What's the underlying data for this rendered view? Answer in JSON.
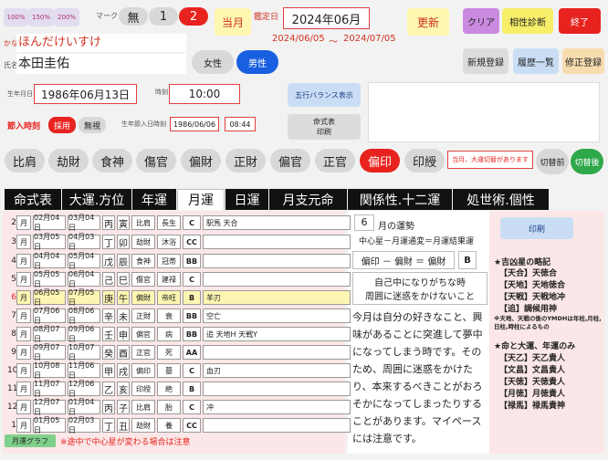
{
  "top": {
    "zoom": [
      "100%",
      "150%",
      "200%"
    ],
    "mark_label": "マーク",
    "mark_buttons": [
      "無",
      "1",
      "2"
    ],
    "current_month_label": "当月",
    "kantei_label": "鑑定日",
    "kantei_value": "2024年06月",
    "period_from": "2024/06/05",
    "period_sep": "～",
    "period_to": "2024/07/05",
    "update_label": "更新",
    "clear_label": "クリア",
    "compat_label": "相性診断",
    "exit_label": "終了",
    "new_label": "新規登録",
    "history_label": "履歴一覧",
    "fix_label": "修正登録"
  },
  "person": {
    "kana_label": "かな",
    "kana_value": "ほんだけいすけ",
    "name_label": "氏名",
    "name_value": "本田圭佑",
    "female_label": "女性",
    "male_label": "男性",
    "birth_label": "生年月日",
    "birth_value": "1986年06月13日",
    "time_label": "時刻",
    "time_value": "10:00",
    "gogyo_label": "五行バランス表示",
    "meishiki_print_line1": "命式表",
    "meishiki_print_line2": "印刷",
    "setsuiri_label": "節入時刻",
    "adopt_label": "採用",
    "ignore_label": "無視",
    "birth_setsu_label": "生年節入日時刻",
    "birth_setsu_date": "1986/06/06",
    "birth_setsu_time": "08:44"
  },
  "stars": [
    "比肩",
    "劫財",
    "食神",
    "傷官",
    "偏財",
    "正財",
    "偏官",
    "正官",
    "偏印",
    "印綬"
  ],
  "star_notice": "当月、大運切替があります",
  "switch_before": "切替前",
  "switch_after": "切替後",
  "tabs": [
    "命式表",
    "大運.方位",
    "年運",
    "月運",
    "日運",
    "月支元命",
    "関係性.十二運",
    "処世術.個性"
  ],
  "months": [
    {
      "m": "2",
      "u": "月",
      "s": "02月04日",
      "e": "03月04日",
      "g1": "丙",
      "g2": "寅",
      "star": "比肩",
      "un": "長生",
      "code": "C",
      "note": "駅馬 天合"
    },
    {
      "m": "3",
      "u": "月",
      "s": "03月05日",
      "e": "04月03日",
      "g1": "丁",
      "g2": "卯",
      "star": "劫財",
      "un": "沐浴",
      "code": "CC",
      "note": ""
    },
    {
      "m": "4",
      "u": "月",
      "s": "04月04日",
      "e": "05月04日",
      "g1": "戊",
      "g2": "辰",
      "star": "食神",
      "un": "冠帯",
      "code": "BB",
      "note": ""
    },
    {
      "m": "5",
      "u": "月",
      "s": "05月05日",
      "e": "06月04日",
      "g1": "己",
      "g2": "巳",
      "star": "傷官",
      "un": "建禄",
      "code": "C",
      "note": ""
    },
    {
      "m": "6",
      "u": "月",
      "s": "06月05日",
      "e": "07月05日",
      "g1": "庚",
      "g2": "午",
      "star": "偏財",
      "un": "帝旺",
      "code": "B",
      "note": "羊刃"
    },
    {
      "m": "7",
      "u": "月",
      "s": "07月06日",
      "e": "08月06日",
      "g1": "辛",
      "g2": "未",
      "star": "正財",
      "un": "衰",
      "code": "BB",
      "note": "空亡"
    },
    {
      "m": "8",
      "u": "月",
      "s": "08月07日",
      "e": "09月06日",
      "g1": "壬",
      "g2": "申",
      "star": "偏官",
      "un": "病",
      "code": "BB",
      "note": "追 天地H 天戦Y"
    },
    {
      "m": "9",
      "u": "月",
      "s": "09月07日",
      "e": "10月07日",
      "g1": "癸",
      "g2": "酉",
      "star": "正官",
      "un": "死",
      "code": "AA",
      "note": ""
    },
    {
      "m": "10",
      "u": "月",
      "s": "10月08日",
      "e": "11月06日",
      "g1": "甲",
      "g2": "戌",
      "star": "偏印",
      "un": "墓",
      "code": "C",
      "note": "血刃"
    },
    {
      "m": "11",
      "u": "月",
      "s": "11月07日",
      "e": "12月06日",
      "g1": "乙",
      "g2": "亥",
      "star": "印綬",
      "un": "絶",
      "code": "B",
      "note": ""
    },
    {
      "m": "12",
      "u": "月",
      "s": "12月07日",
      "e": "01月04日",
      "g1": "丙",
      "g2": "子",
      "star": "比肩",
      "un": "胎",
      "code": "C",
      "note": "冲"
    },
    {
      "m": "1",
      "u": "月",
      "s": "01月05日",
      "e": "02月03日",
      "g1": "丁",
      "g2": "丑",
      "star": "劫財",
      "un": "養",
      "code": "CC",
      "note": ""
    }
  ],
  "bottom": {
    "graph_label": "月運グラフ",
    "note": "※途中で中心星が変わる場合は注意"
  },
  "fortune": {
    "month": "6",
    "month_suffix": "月の運勢",
    "formula": "中心星－月運通変＝月運結果運",
    "print_label": "印刷",
    "result_formula": "偏印 － 偏財 ＝ 偏財",
    "result_grade": "B",
    "caution_line1": "自己中になりがちな時",
    "caution_line2": "周囲に迷惑をかけないこと",
    "body": "今月は自分の好きなこと、興味があることに突進して夢中になってしまう時です。そのため、周囲に迷惑をかけたり、本来するべきことがおろそかになってしまったりすることがあります。マイペースには注意です。"
  },
  "side": {
    "kichi_title": "★吉凶星の略記",
    "kichi_items": [
      "【天合】天徳合",
      "【天地】天地徳合",
      "【天戦】天戦地冲",
      "【追】調候用神"
    ],
    "kichi_note": "※天地、天戦の後のYMDHは年柱,月柱,日柱,時柱によるもの",
    "noble_title": "★命と大運、年運のみ",
    "noble_items": [
      "【天乙】天乙貴人",
      "【文昌】文昌貴人",
      "【天徳】天徳貴人",
      "【月徳】月徳貴人",
      "【禄馬】禄馬貴神"
    ]
  },
  "colors": {
    "red": "#e8231f",
    "blue": "#1a5fe0",
    "highlight_row": "#fdf6b2",
    "pink_panel": "#fbe7e7"
  }
}
